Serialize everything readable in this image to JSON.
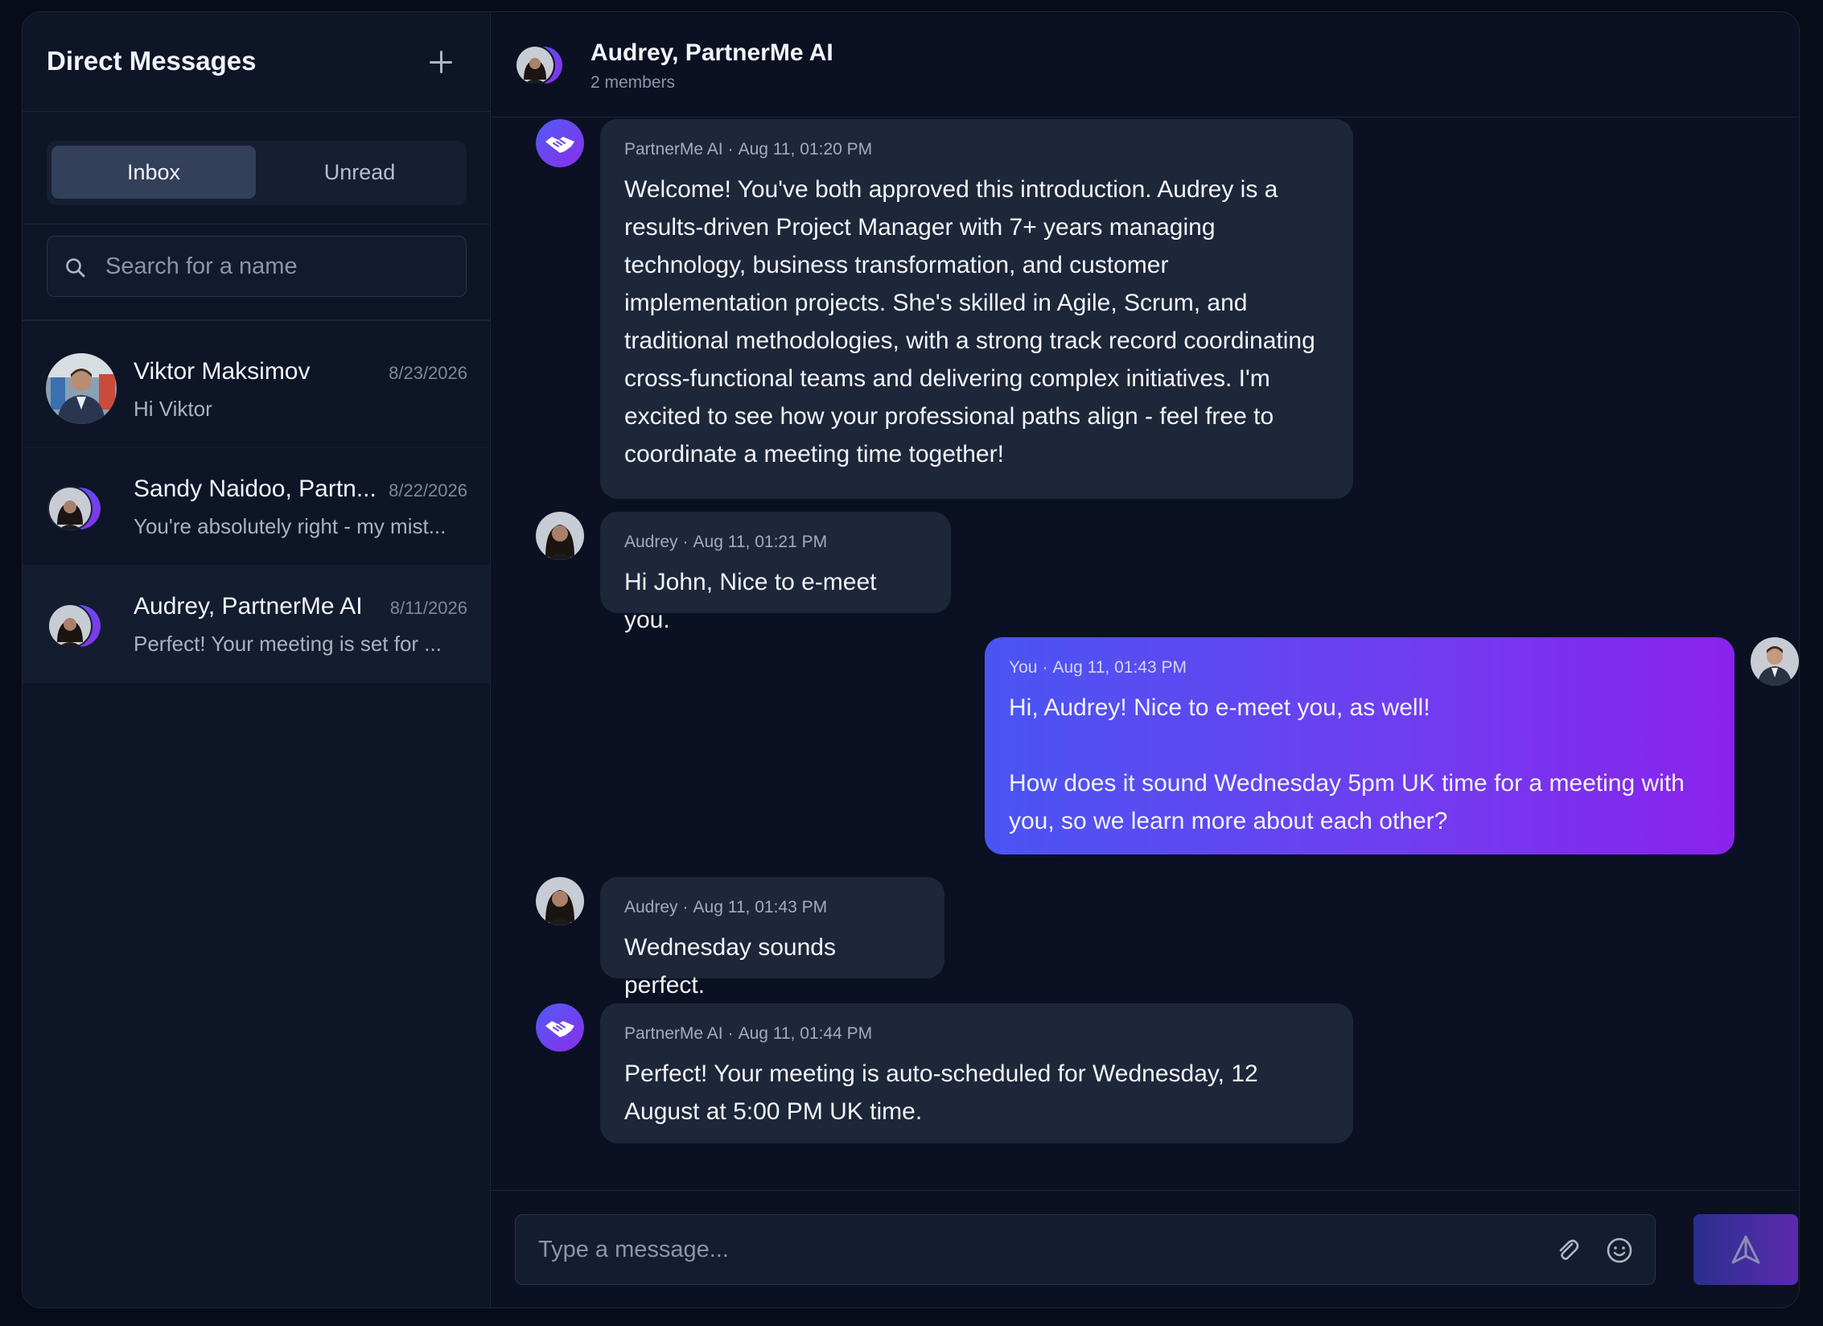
{
  "sidebar": {
    "title": "Direct Messages",
    "tabs": [
      {
        "label": "Inbox",
        "active": true
      },
      {
        "label": "Unread",
        "active": false
      }
    ],
    "search": {
      "placeholder": "Search for a name"
    },
    "conversations": [
      {
        "name": "Viktor Maksimov",
        "date": "8/23/2026",
        "preview": "Hi Viktor"
      },
      {
        "name": "Sandy Naidoo, Partn...",
        "date": "8/22/2026",
        "preview": "You're absolutely right - my mist..."
      },
      {
        "name": "Audrey, PartnerMe AI",
        "date": "8/11/2026",
        "preview": "Perfect! Your meeting is set for ..."
      }
    ]
  },
  "chat": {
    "title": "Audrey, PartnerMe AI",
    "subtitle": "2 members",
    "messages": [
      {
        "sender": "PartnerMe AI",
        "time": "Aug 11, 01:20 PM",
        "text": "Welcome! You've both approved this introduction. Audrey is a results-driven Project Manager with 7+ years managing technology, business transformation, and customer implementation projects. She's skilled in Agile, Scrum, and traditional methodologies, with a strong track record coordinating cross-functional teams and delivering complex initiatives. I'm excited to see how your professional paths align - feel free to coordinate a meeting time together!"
      },
      {
        "sender": "Audrey",
        "time": "Aug 11, 01:21 PM",
        "text": "Hi John, Nice to e-meet you."
      },
      {
        "sender": "You",
        "time": "Aug 11, 01:43 PM",
        "text": "Hi, Audrey! Nice to e-meet you, as well!\n\nHow does it sound Wednesday 5pm UK time for a meeting with you, so we learn more about each other?"
      },
      {
        "sender": "Audrey",
        "time": "Aug 11, 01:43 PM",
        "text": "Wednesday sounds perfect."
      },
      {
        "sender": "PartnerMe AI",
        "time": "Aug 11, 01:44 PM",
        "text": "Perfect! Your meeting is auto-scheduled for Wednesday, 12 August at 5:00 PM UK time."
      }
    ],
    "composer": {
      "placeholder": "Type a message..."
    }
  },
  "colors": {
    "background": "#0b1123",
    "bubble": "#1e263a",
    "accent_start": "#4a55f2",
    "accent_end": "#8a22ec"
  },
  "icons": [
    "plus-icon",
    "search-icon",
    "paperclip-icon",
    "smiley-icon",
    "send-icon",
    "handshake-icon"
  ]
}
